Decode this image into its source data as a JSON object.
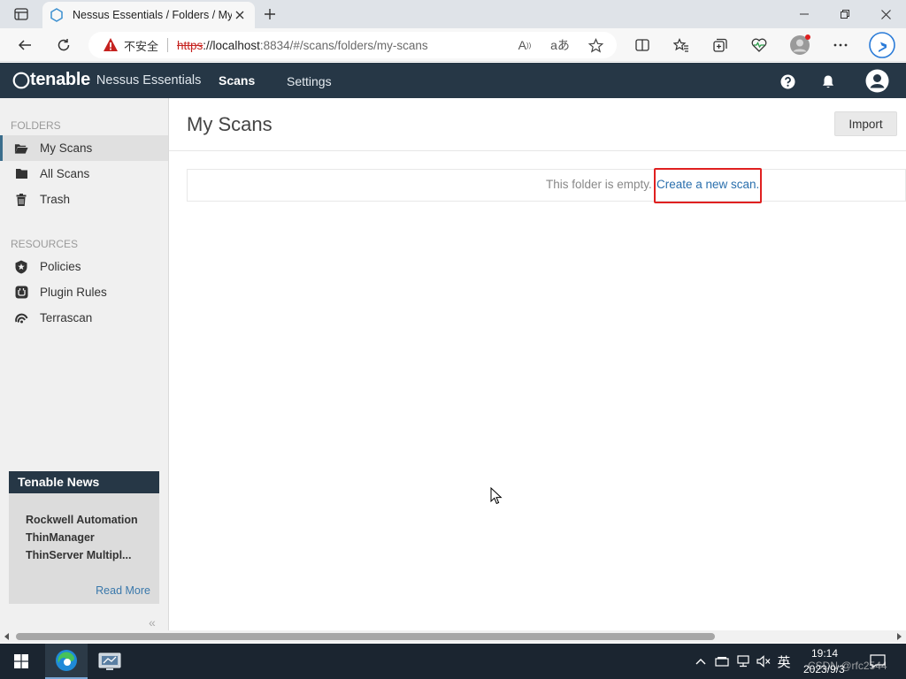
{
  "browser": {
    "tab_title": "Nessus Essentials / Folders / My Scans",
    "not_secure_label": "不安全",
    "url_protocol": "https",
    "url_host": "://localhost",
    "url_rest": ":8834/#/scans/folders/my-scans"
  },
  "header": {
    "brand": "tenable",
    "product": "Nessus Essentials",
    "nav_scans": "Scans",
    "nav_settings": "Settings"
  },
  "sidebar": {
    "folders_label": "FOLDERS",
    "folders": [
      {
        "label": "My Scans",
        "icon": "folder-open-icon",
        "active": true
      },
      {
        "label": "All Scans",
        "icon": "folder-icon"
      },
      {
        "label": "Trash",
        "icon": "trash-icon"
      }
    ],
    "resources_label": "RESOURCES",
    "resources": [
      {
        "label": "Policies",
        "icon": "shield-icon"
      },
      {
        "label": "Plugin Rules",
        "icon": "plugin-icon"
      },
      {
        "label": "Terrascan",
        "icon": "terrascan-icon"
      }
    ],
    "news": {
      "title": "Tenable News",
      "line1": "Rockwell Automation",
      "line2": "ThinManager",
      "line3": "ThinServer Multipl...",
      "read_more": "Read More"
    },
    "collapse_glyph": "«"
  },
  "main": {
    "title": "My Scans",
    "import_label": "Import",
    "empty_text": "This folder is empty.",
    "create_link": "Create a new scan."
  },
  "taskbar": {
    "ime": "英",
    "time": "19:14",
    "date": "2023/9/3",
    "watermark": "CSDN @rfc2544"
  },
  "colors": {
    "header_bg": "#263746",
    "link": "#2a6fad",
    "highlight": "#e02020",
    "taskbar_bg": "#1b2530"
  }
}
